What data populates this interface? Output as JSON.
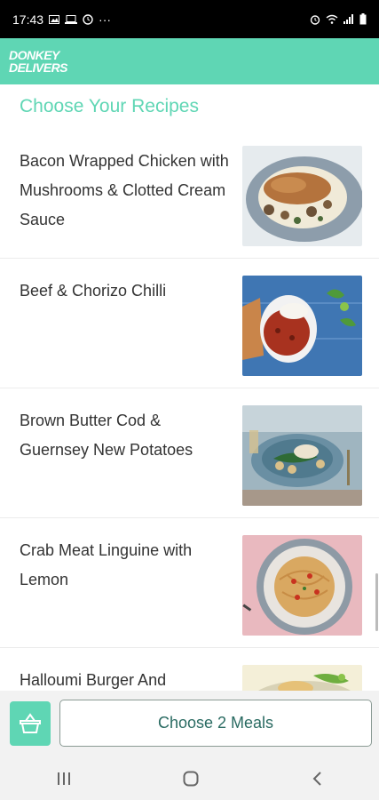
{
  "status_bar": {
    "time": "17:43",
    "more": "···"
  },
  "app_bar": {
    "logo_line1": "DONKEY",
    "logo_line2": "DELIVERS"
  },
  "page_title": "Choose Your Recipes",
  "recipes": [
    {
      "name": "Bacon Wrapped Chicken with Mushrooms & Clotted Cream Sauce",
      "image": "chicken-plate-image"
    },
    {
      "name": "Beef & Chorizo Chilli",
      "image": "chilli-bowl-image"
    },
    {
      "name": "Brown Butter Cod & Guernsey New Potatoes",
      "image": "cod-plate-image"
    },
    {
      "name": "Crab Meat Linguine with Lemon",
      "image": "linguine-plate-image"
    },
    {
      "name": "Halloumi Burger And",
      "image": "burger-image"
    }
  ],
  "footer": {
    "choose_label": "Choose 2 Meals"
  },
  "colors": {
    "accent": "#5fd6b4",
    "button_text": "#2a6b62"
  },
  "icons": {
    "basket": "basket-icon",
    "nav_recent": "recent-apps-icon",
    "nav_home": "home-icon",
    "nav_back": "back-icon"
  }
}
